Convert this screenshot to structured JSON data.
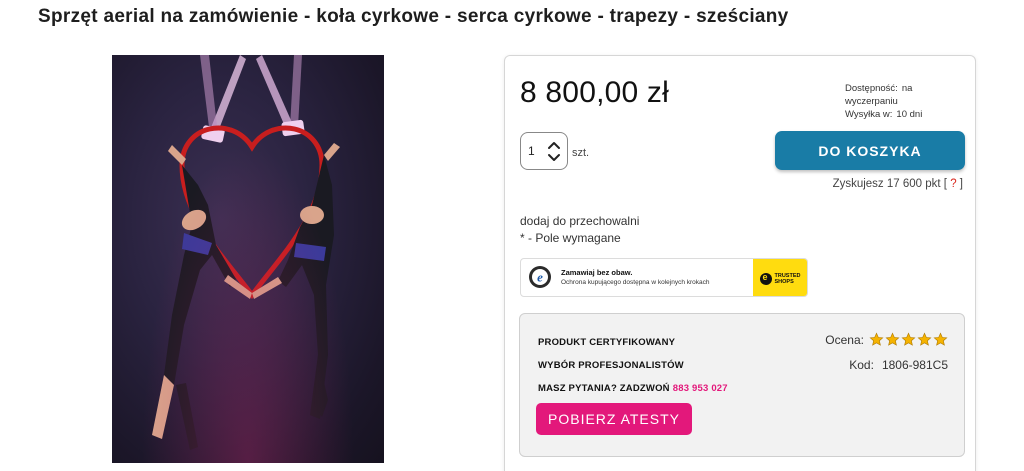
{
  "product": {
    "title": "Sprzęt aerial na zamówienie - koła cyrkowe - serca cyrkowe - trapezy - sześciany"
  },
  "buy_box": {
    "price": "8 800,00 zł",
    "availability_label": "Dostępność:",
    "availability_value": "na wyczerpaniu",
    "shipping_label": "Wysyłka w:",
    "shipping_value": "10 dni",
    "quantity_value": "1",
    "quantity_unit": "szt.",
    "add_to_cart_label": "DO KOSZYKA",
    "points_text": "Zyskujesz 17 600 pkt [",
    "points_help": "?",
    "points_close": "]",
    "storage_link": "dodaj do przechowalni",
    "required_note": "* - Pole wymagane"
  },
  "trusted_shops": {
    "headline": "Zamawiaj bez obaw.",
    "subline": "Ochrona kupującego dostępna w kolejnych krokach",
    "logo_text_line1": "TRUSTED",
    "logo_text_line2": "SHOPS"
  },
  "certification": {
    "line1": "PRODUKT CERTYFIKOWANY",
    "line2": "WYBÓR PROFESJONALISTÓW",
    "line3": "MASZ PYTANIA? ZADZWOŃ",
    "phone": "883 953 027",
    "rating_label": "Ocena:",
    "rating_stars": 5,
    "code_label": "Kod:",
    "code_value": "1806-981C5",
    "download_button": "POBIERZ ATESTY"
  },
  "colors": {
    "cart_button": "#197ca6",
    "accent_pink": "#e3187b",
    "star": "#f5b301",
    "trusted_yellow": "#ffdc0f"
  },
  "icons": [
    "spinner-up-icon",
    "spinner-down-icon",
    "star-icon",
    "ehi-badge-icon",
    "trusted-shops-logo"
  ]
}
